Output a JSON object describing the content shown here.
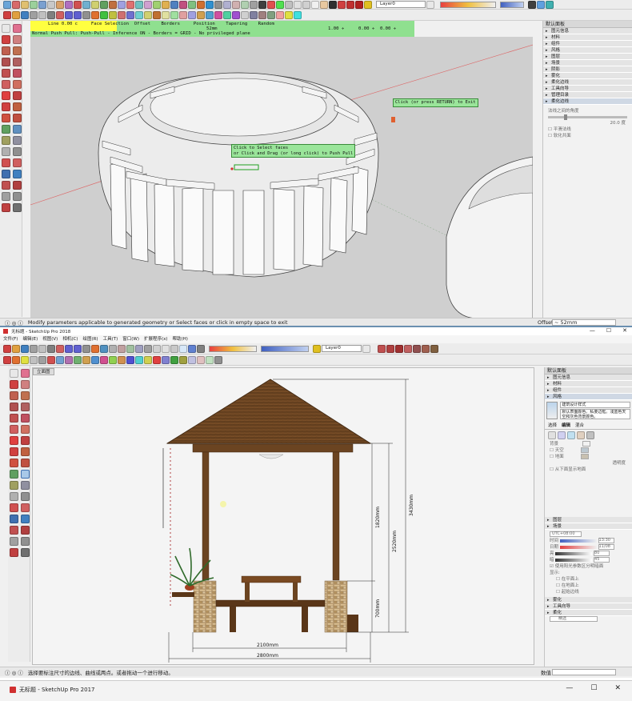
{
  "top_window": {
    "layer_select": "Layer0",
    "plugin_bar": {
      "row1": "Line 0.00 c     Face Selection  Offset    Borders     Position    Tapering    Random",
      "row2": "Normal Push Pull: Push-Pull - Inference ON - Borders = GRID - No privileged plane",
      "offset_value": "52mm",
      "tapering_value": "1.00 ÷",
      "random_value": "0.00 ÷  0.00 ÷"
    },
    "tooltip_exit": "Click (or press RETURN) to Exit",
    "tooltip_select": "Click to Select faces\nor Click and Drag (or long click) to Push Pull",
    "status_text": "Modify parameters applicable to generated geometry or Select faces or click in empty space to exit",
    "offset_label": "Offset",
    "offset_value": "~ 52mm",
    "tray": {
      "title": "默认面板",
      "items": [
        "图元信息",
        "材料",
        "组件",
        "风格",
        "图层",
        "场景",
        "阴影",
        "雾化",
        "柔化边线",
        "工具向导",
        "管理目录",
        "柔化边线"
      ],
      "soften_label": "法线之间的角度",
      "soften_value": "20.0 度",
      "checks": [
        "平滑法线",
        "软化共面"
      ]
    }
  },
  "bottom_window": {
    "title": "无标题 - SketchUp Pro 2018",
    "menu": [
      "文件(F)",
      "编辑(E)",
      "视图(V)",
      "相机(C)",
      "绘图(R)",
      "工具(T)",
      "窗口(W)",
      "扩展程序(x)",
      "帮助(H)"
    ],
    "layer_select": "Layer0",
    "scene_tab": "立面图",
    "status_text": "选择要标注尺寸的边线、曲线或两点。或者拖动一个进行移动。",
    "measure_label": "数值",
    "dimensions": {
      "width_inner": "2100mm",
      "width_outer": "2800mm",
      "h1": "1820mm",
      "h2": "2520mm",
      "h3": "3430mm",
      "h4": "700mm"
    },
    "tray": {
      "title": "默认面板",
      "top_items": [
        "图元信息",
        "材料",
        "组件",
        "风格"
      ],
      "style_name": "建筑设计样式",
      "style_desc": "默认表面颜色。私要边框。浅蓝色天空和灰色背景颜色。",
      "tabs": [
        "选择",
        "编辑",
        "混合"
      ],
      "bg_labels": [
        "背景",
        "天空",
        "地面"
      ],
      "transparency_label": "透明度",
      "show_ground_below": "从下面显示地面",
      "mid_items": [
        "图层",
        "场景"
      ],
      "shadow": {
        "utc_value": "UTC+08:00",
        "time_label": "时间",
        "date_label": "日期",
        "time_value": "13:30",
        "date_value": "11/08",
        "light_label": "亮",
        "dark_label": "暗",
        "light_value": "80",
        "dark_value": "45",
        "sun_check": "使用阳光参数区分明暗面",
        "display_label": "显示:",
        "display_items": [
          "在平面上",
          "在地面上",
          "起始边线"
        ]
      },
      "bottom_items": [
        "雾化",
        "工具向导",
        "柔化"
      ],
      "bottom_field": "精选"
    }
  },
  "bottom_bar_window": {
    "title": "无标题 - SketchUp Pro 2017",
    "controls": [
      "—",
      "☐",
      "✕"
    ]
  },
  "colors": {
    "viewport_grey": "#cfcfcf",
    "viewport_white": "#f4f4f4",
    "plugin_yellow": "#ffff40",
    "plugin_green": "#8fe08f",
    "wood_dark": "#6b4421",
    "wood_mid": "#8a5a2f"
  }
}
